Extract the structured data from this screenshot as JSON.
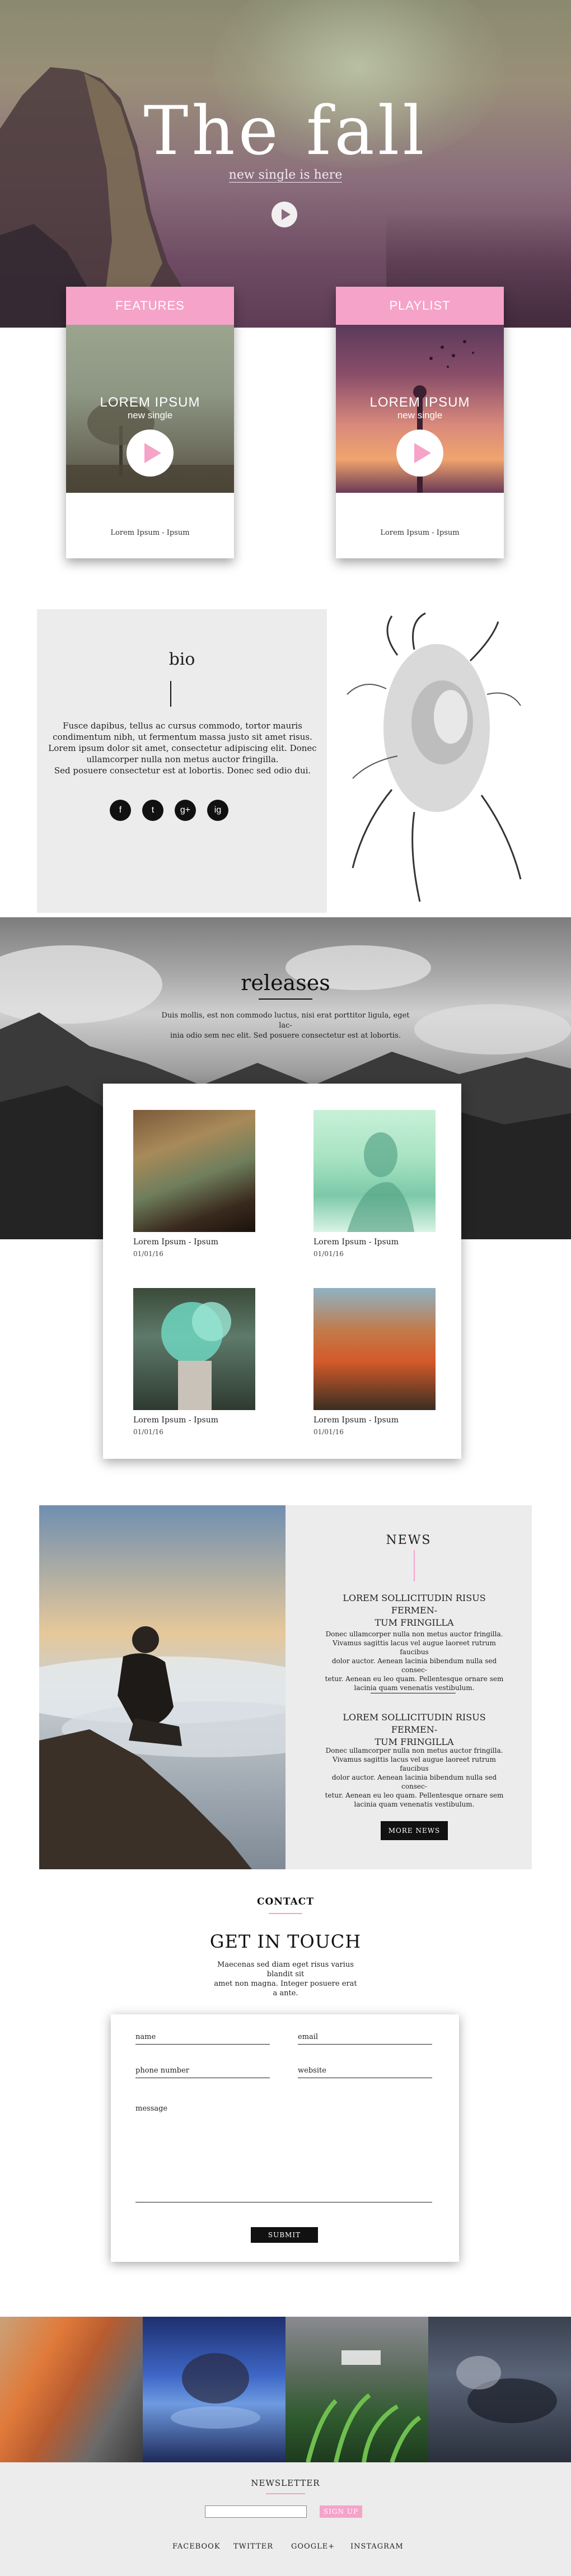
{
  "hero": {
    "title": "The fall",
    "subtitle": "new single is here"
  },
  "cards": [
    {
      "header": "FEATURES",
      "lorem": "LOREM IPSUM",
      "sub": "new single",
      "caption": "Lorem Ipsum - Ipsum"
    },
    {
      "header": "PLAYLIST",
      "lorem": "LOREM IPSUM",
      "sub": "new single",
      "caption": "Lorem Ipsum - Ipsum"
    }
  ],
  "bio": {
    "title": "bio",
    "lines": [
      "Fusce dapibus, tellus ac cursus commodo, tortor mauris",
      "condimentum nibh, ut fermentum massa justo sit amet risus.",
      "Lorem ipsum dolor sit amet, consectetur adipiscing elit. Donec",
      "ullamcorper nulla non metus auctor fringilla.",
      "Sed posuere consectetur est at lobortis. Donec sed odio dui."
    ],
    "social": [
      "f",
      "t",
      "g+",
      "ig"
    ]
  },
  "releases": {
    "title": "releases",
    "lines": [
      "Duis mollis, est non commodo luctus, nisi erat porttitor ligula, eget lac-",
      "inia odio sem nec elit. Sed posuere consectetur est at lobortis."
    ],
    "items": [
      {
        "title": "Lorem Ipsum - Ipsum",
        "date": "01/01/16"
      },
      {
        "title": "Lorem Ipsum - Ipsum",
        "date": "01/01/16"
      },
      {
        "title": "Lorem Ipsum - Ipsum",
        "date": "01/01/16"
      },
      {
        "title": "Lorem Ipsum - Ipsum",
        "date": "01/01/16"
      }
    ]
  },
  "news": {
    "title": "NEWS",
    "items": [
      {
        "head1": "LOREM SOLLICITUDIN RISUS FERMEN-",
        "head2": "TUM FRINGILLA",
        "body": [
          "Donec ullamcorper nulla non metus auctor fringilla.",
          "Vivamus sagittis lacus vel augue laoreet rutrum faucibus",
          "dolor auctor. Aenean lacinia bibendum nulla sed consec-",
          "tetur. Aenean eu leo quam. Pellentesque ornare sem",
          "lacinia quam venenatis vestibulum."
        ]
      },
      {
        "head1": "LOREM SOLLICITUDIN RISUS FERMEN-",
        "head2": "TUM FRINGILLA",
        "body": [
          "Donec ullamcorper nulla non metus auctor fringilla.",
          "Vivamus sagittis lacus vel augue laoreet rutrum faucibus",
          "dolor auctor. Aenean lacinia bibendum nulla sed consec-",
          "tetur. Aenean eu leo quam. Pellentesque ornare sem",
          "lacinia quam venenatis vestibulum."
        ]
      }
    ],
    "button": "MORE NEWS"
  },
  "contact": {
    "label": "CONTACT",
    "heading": "GET IN TOUCH",
    "lines": [
      "Maecenas sed diam eget risus varius blandit sit",
      "amet non magna. Integer posuere erat a ante."
    ],
    "fields": {
      "name": "name",
      "email": "email",
      "phone": "phone number",
      "website": "website",
      "message": "message"
    },
    "submit": "SUBMIT"
  },
  "footer": {
    "newsletter": "NEWSLETTER",
    "signup": "SIGN UP",
    "links": [
      "FACEBOOK",
      "TWITTER",
      "GOOGLE+",
      "INSTAGRAM"
    ]
  },
  "colors": {
    "accent": "#f5a3c9",
    "panel": "#ececec",
    "dark": "#111111"
  }
}
